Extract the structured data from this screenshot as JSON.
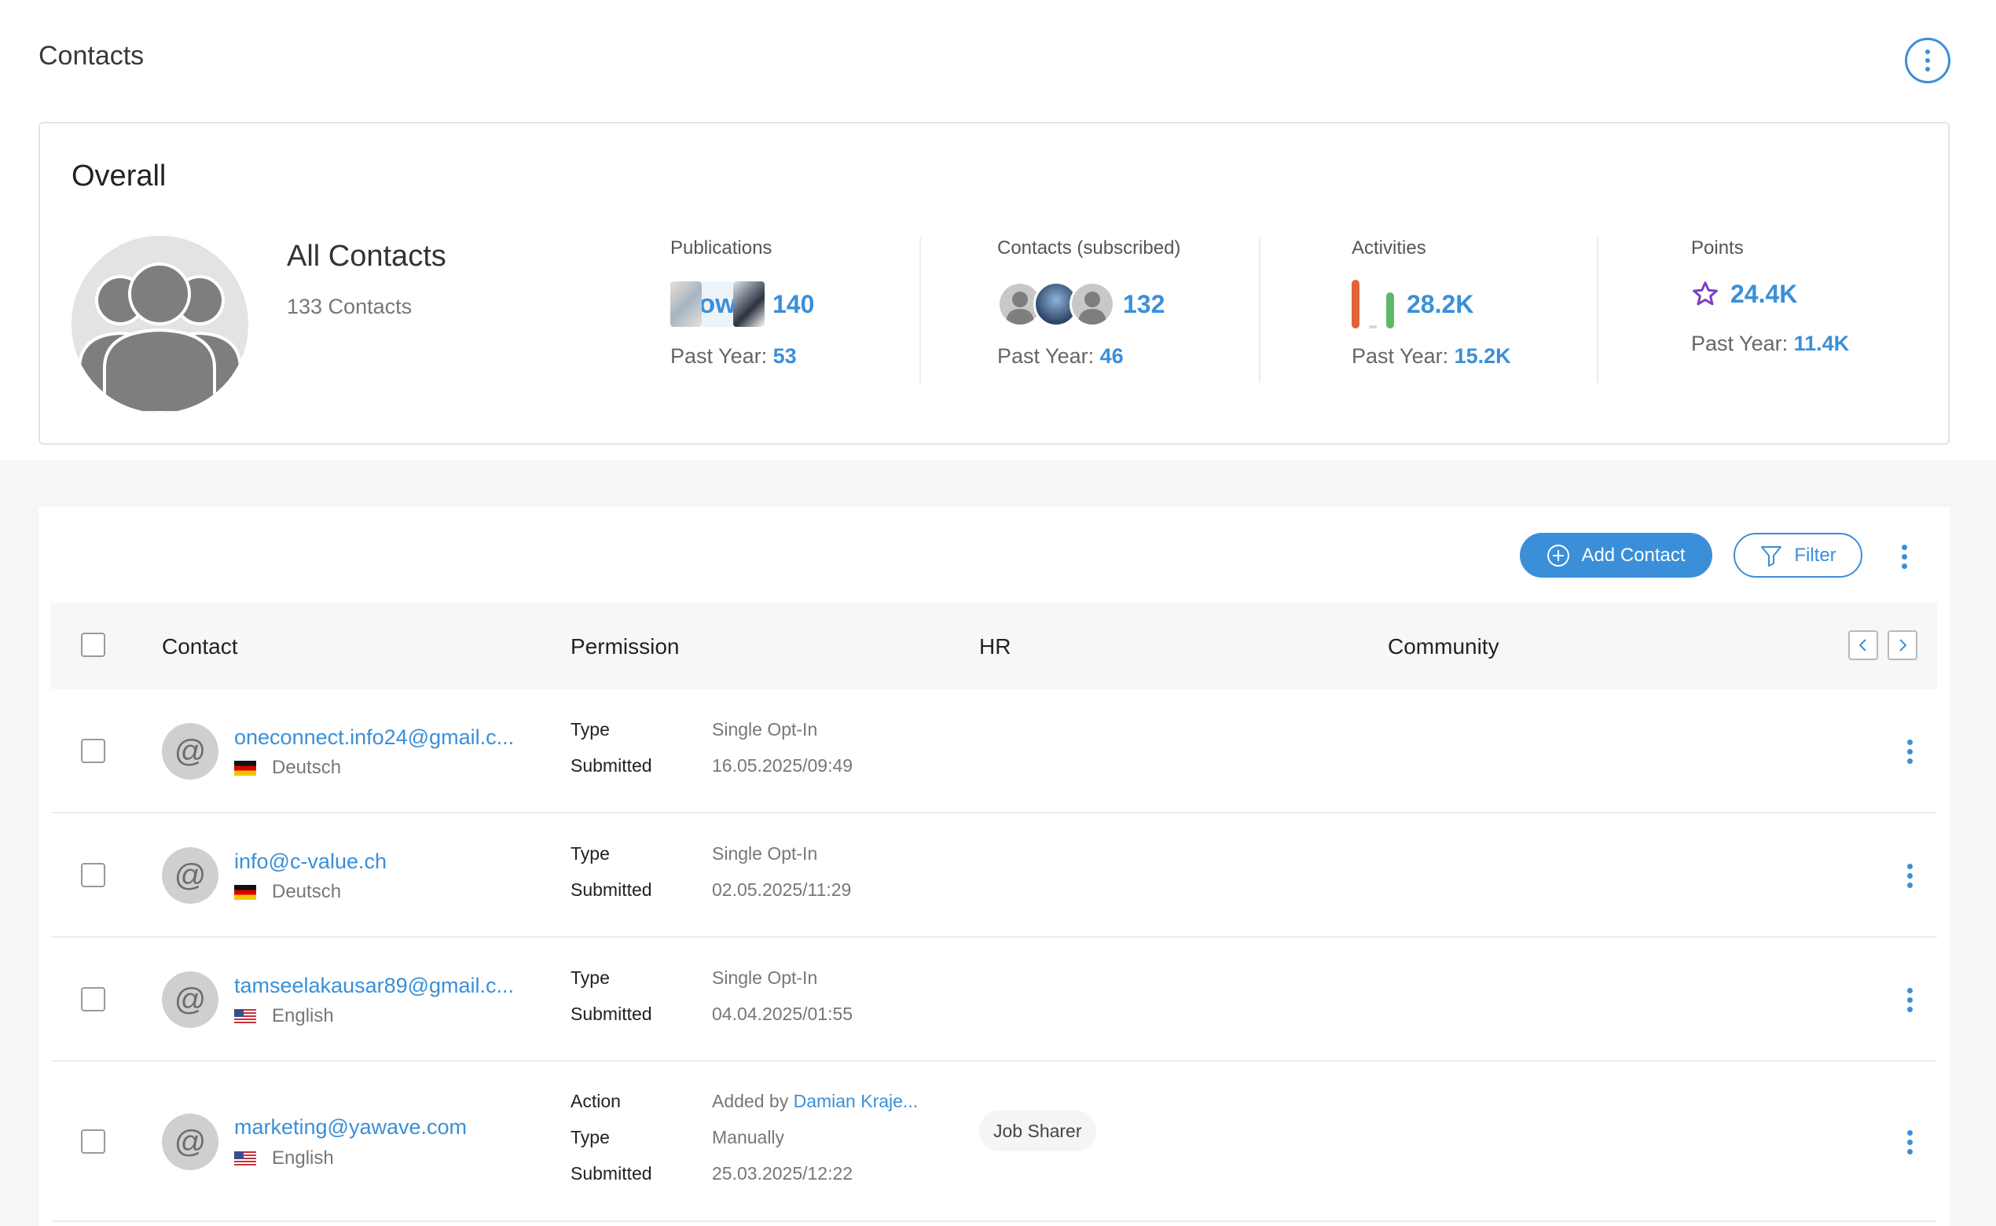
{
  "header": {
    "title": "Contacts"
  },
  "overall": {
    "title": "Overall",
    "all_contacts": {
      "title": "All Contacts",
      "count_text": "133 Contacts"
    },
    "stats": {
      "publications": {
        "label": "Publications",
        "value": "140",
        "past_year_label": "Past Year:",
        "past_year_value": "53"
      },
      "contacts_subscribed": {
        "label": "Contacts (subscribed)",
        "value": "132",
        "past_year_label": "Past Year:",
        "past_year_value": "46"
      },
      "activities": {
        "label": "Activities",
        "value": "28.2K",
        "past_year_label": "Past Year:",
        "past_year_value": "15.2K"
      },
      "points": {
        "label": "Points",
        "value": "24.4K",
        "past_year_label": "Past Year:",
        "past_year_value": "11.4K"
      }
    }
  },
  "toolbar": {
    "add_label": "Add Contact",
    "filter_label": "Filter"
  },
  "table": {
    "columns": [
      "Contact",
      "Permission",
      "HR",
      "Community"
    ],
    "rows": [
      {
        "email": "oneconnect.info24@gmail.c...",
        "language": "Deutsch",
        "permission": [
          {
            "k": "Type",
            "v": "Single Opt-In"
          },
          {
            "k": "Submitted",
            "v": "16.05.2025/09:49"
          }
        ]
      },
      {
        "email": "info@c-value.ch",
        "language": "Deutsch",
        "permission": [
          {
            "k": "Type",
            "v": "Single Opt-In"
          },
          {
            "k": "Submitted",
            "v": "02.05.2025/11:29"
          }
        ]
      },
      {
        "email": "tamseelakausar89@gmail.c...",
        "language": "English",
        "permission": [
          {
            "k": "Type",
            "v": "Single Opt-In"
          },
          {
            "k": "Submitted",
            "v": "04.04.2025/01:55"
          }
        ]
      },
      {
        "email": "marketing@yawave.com",
        "language": "English",
        "permission": [
          {
            "k": "Action",
            "v": "Added by",
            "link": "Damian Kraje..."
          },
          {
            "k": "Type",
            "v": "Manually"
          },
          {
            "k": "Submitted",
            "v": "25.03.2025/12:22"
          }
        ],
        "hr_tag": "Job Sharer"
      }
    ]
  },
  "colors": {
    "accent": "#3a8fd8",
    "star": "#7b3fbf",
    "activity_orange": "#e0643a",
    "activity_green": "#5cb96a"
  }
}
